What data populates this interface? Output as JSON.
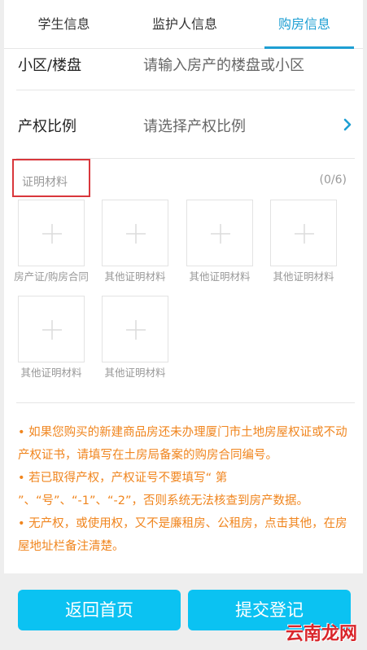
{
  "tabs": [
    {
      "label": "学生信息"
    },
    {
      "label": "监护人信息"
    },
    {
      "label": "购房信息"
    }
  ],
  "form": {
    "community": {
      "label": "小区/楼盘",
      "placeholder": "请输入房产的楼盘或小区"
    },
    "ownership": {
      "label": "产权比例",
      "placeholder": "请选择产权比例"
    }
  },
  "materials": {
    "title": "证明材料",
    "count": "(0/6)",
    "items": [
      {
        "caption": "房产证/购房合同"
      },
      {
        "caption": "其他证明材料"
      },
      {
        "caption": "其他证明材料"
      },
      {
        "caption": "其他证明材料"
      },
      {
        "caption": "其他证明材料"
      },
      {
        "caption": "其他证明材料"
      }
    ]
  },
  "notes": [
    "• 如果您购买的新建商品房还未办理厦门市土地房屋权证或不动产权证书，请填写在土房局备案的购房合同编号。",
    "• 若已取得产权，产权证号不要填写“ 第 ”、“号”、“-1”、“-2”，否则系统无法核查到房产数据。",
    "• 无产权，或使用权，又不是廉租房、公租房，点击其他，在房屋地址栏备注清楚。"
  ],
  "buttons": {
    "back": "返回首页",
    "submit": "提交登记"
  },
  "watermark": "云南龙网",
  "colors": {
    "accent": "#1e9fd3",
    "button": "#0bc2f2",
    "note": "#f0851e",
    "highlight_box": "#d9373c"
  }
}
